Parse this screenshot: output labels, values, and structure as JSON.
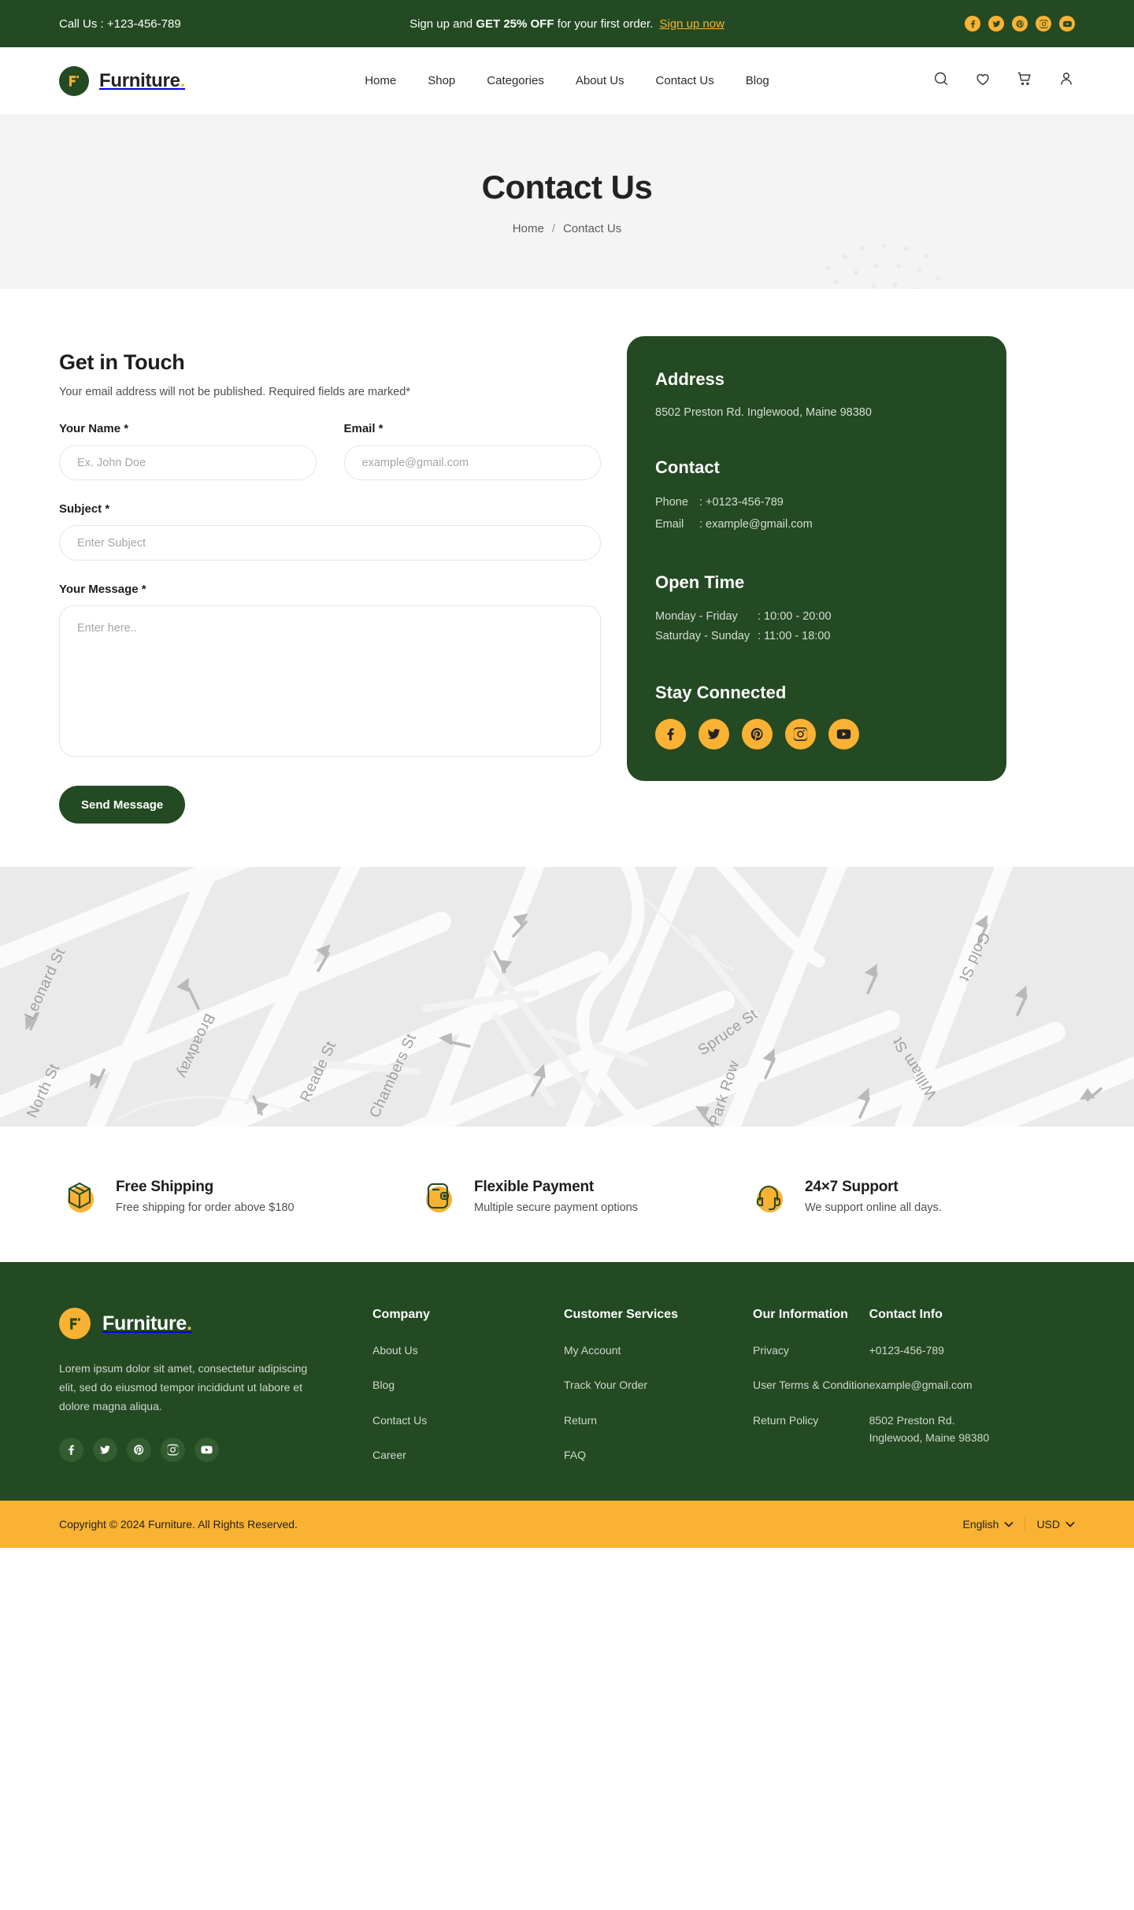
{
  "topbar": {
    "call_label": "Call Us :  +123-456-789",
    "promo_prefix": "Sign up and ",
    "promo_bold": "GET 25% OFF",
    "promo_suffix": " for your first order.",
    "signup_link": "Sign up now",
    "socials": [
      "facebook-icon",
      "twitter-icon",
      "pinterest-icon",
      "instagram-icon",
      "youtube-icon"
    ]
  },
  "navbar": {
    "brand": "Furniture",
    "brand_dot": ".",
    "links": [
      "Home",
      "Shop",
      "Categories",
      "About Us",
      "Contact Us",
      "Blog"
    ],
    "icons": [
      "search-icon",
      "wishlist-heart-icon",
      "cart-icon",
      "account-icon"
    ]
  },
  "pagehead": {
    "title": "Contact Us",
    "breadcrumb_home": "Home",
    "breadcrumb_sep": "/",
    "breadcrumb_current": "Contact Us"
  },
  "form": {
    "heading": "Get in Touch",
    "note": "Your email address will not be published. Required fields are marked*",
    "name_label": "Your Name *",
    "name_placeholder": "Ex. John Doe",
    "name_value": "",
    "email_label": "Email *",
    "email_placeholder": "example@gmail.com",
    "email_value": "",
    "subject_label": "Subject *",
    "subject_placeholder": "Enter Subject",
    "subject_value": "",
    "message_label": "Your Message *",
    "message_placeholder": "Enter here..",
    "message_value": "",
    "submit_label": "Send Message"
  },
  "info_card": {
    "address_title": "Address",
    "address_text": "8502 Preston Rd. Inglewood, Maine 98380",
    "contact_title": "Contact",
    "phone_key": "Phone",
    "phone_value": ": +0123-456-789",
    "email_key": "Email",
    "email_value": ": example@gmail.com",
    "open_title": "Open Time",
    "weekday_key": "Monday - Friday",
    "weekday_value": ": 10:00 - 20:00",
    "weekend_key": "Saturday - Sunday",
    "weekend_value": ": 11:00 - 18:00",
    "stay_title": "Stay Connected",
    "socials": [
      "facebook-icon",
      "twitter-icon",
      "pinterest-icon",
      "instagram-icon",
      "youtube-icon"
    ]
  },
  "map": {
    "labels": [
      "Leonard St",
      "Broadway",
      "North St",
      "Reade St",
      "Chambers St",
      "Spruce St",
      "Park Row",
      "William St",
      "Gold St"
    ]
  },
  "features": [
    {
      "icon": "shipping-box-icon",
      "title": "Free Shipping",
      "desc": "Free shipping for order above $180"
    },
    {
      "icon": "wallet-icon",
      "title": "Flexible Payment",
      "desc": "Multiple secure payment options"
    },
    {
      "icon": "headset-icon",
      "title": "24×7 Support",
      "desc": "We support online all days."
    }
  ],
  "footer": {
    "brand": "Furniture",
    "brand_dot": ".",
    "description": "Lorem ipsum dolor sit amet, consectetur adipiscing elit, sed do eiusmod tempor incididunt ut labore et dolore magna aliqua.",
    "socials": [
      "facebook-icon",
      "twitter-icon",
      "pinterest-icon",
      "instagram-icon",
      "youtube-icon"
    ],
    "columns": [
      {
        "title": "Company",
        "items": [
          "About Us",
          "Blog",
          "Contact Us",
          "Career"
        ]
      },
      {
        "title": "Customer Services",
        "items": [
          "My Account",
          "Track Your Order",
          "Return",
          "FAQ"
        ]
      },
      {
        "title": "Our Information",
        "items": [
          "Privacy",
          "User Terms & Condition",
          "Return Policy"
        ]
      }
    ],
    "contact_title": "Contact Info",
    "contact_items": [
      "+0123-456-789",
      "example@gmail.com",
      "8502 Preston Rd. Inglewood, Maine 98380"
    ]
  },
  "copyright": {
    "text": "Copyright © 2024 Furniture. All Rights Reserved.",
    "language": "English",
    "currency": "USD"
  },
  "colors": {
    "green": "#234A22",
    "yellow": "#F9B233",
    "page_head_bg": "#F4F4F4",
    "map_bg": "#EAEAEA"
  }
}
